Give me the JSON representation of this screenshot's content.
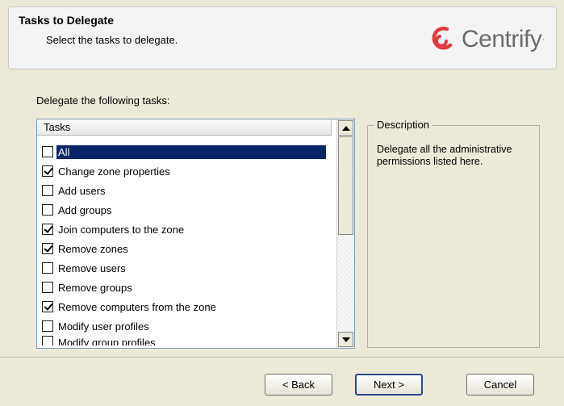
{
  "header": {
    "title": "Tasks to Delegate",
    "subtitle": "Select the tasks to delegate.",
    "logo_text": "Centrify",
    "logo_mark": "·"
  },
  "main": {
    "instruction": "Delegate the following tasks:",
    "list_header": "Tasks",
    "items": [
      {
        "label": "All",
        "checked": false,
        "selected": true
      },
      {
        "label": "Change zone properties",
        "checked": true,
        "selected": false
      },
      {
        "label": "Add users",
        "checked": false,
        "selected": false
      },
      {
        "label": "Add groups",
        "checked": false,
        "selected": false
      },
      {
        "label": "Join computers to the zone",
        "checked": true,
        "selected": false
      },
      {
        "label": "Remove zones",
        "checked": true,
        "selected": false
      },
      {
        "label": "Remove users",
        "checked": false,
        "selected": false
      },
      {
        "label": "Remove groups",
        "checked": false,
        "selected": false
      },
      {
        "label": "Remove computers from the zone",
        "checked": true,
        "selected": false
      },
      {
        "label": "Modify user profiles",
        "checked": false,
        "selected": false
      },
      {
        "label": "Modify group profiles",
        "checked": false,
        "selected": false
      }
    ]
  },
  "description": {
    "legend": "Description",
    "text": "Delegate all the administrative permissions listed here."
  },
  "buttons": {
    "back": "< Back",
    "next": "Next >",
    "cancel": "Cancel"
  },
  "colors": {
    "brand_red": "#e03a3e",
    "selection": "#0a246a",
    "dialog_bg": "#ece9d8"
  }
}
